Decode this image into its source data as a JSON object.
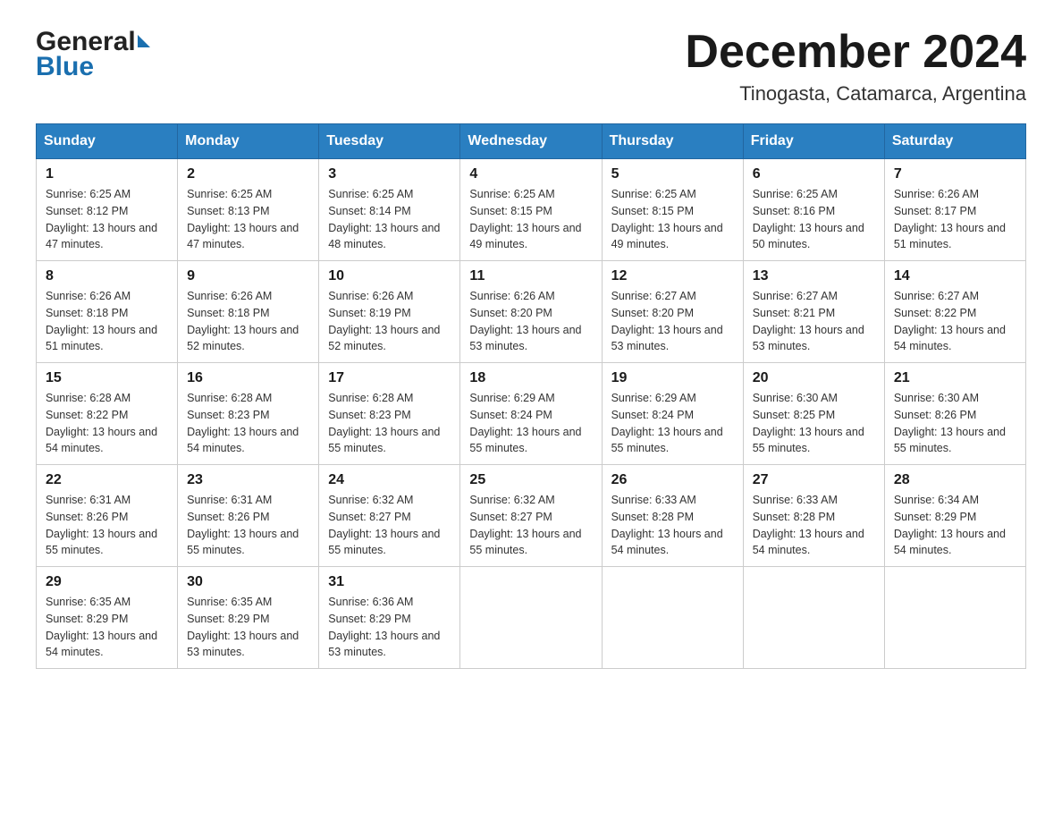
{
  "header": {
    "month_year": "December 2024",
    "location": "Tinogasta, Catamarca, Argentina",
    "logo_general": "General",
    "logo_blue": "Blue"
  },
  "days_of_week": [
    "Sunday",
    "Monday",
    "Tuesday",
    "Wednesday",
    "Thursday",
    "Friday",
    "Saturday"
  ],
  "weeks": [
    [
      {
        "day": "1",
        "sunrise": "6:25 AM",
        "sunset": "8:12 PM",
        "daylight": "13 hours and 47 minutes."
      },
      {
        "day": "2",
        "sunrise": "6:25 AM",
        "sunset": "8:13 PM",
        "daylight": "13 hours and 47 minutes."
      },
      {
        "day": "3",
        "sunrise": "6:25 AM",
        "sunset": "8:14 PM",
        "daylight": "13 hours and 48 minutes."
      },
      {
        "day": "4",
        "sunrise": "6:25 AM",
        "sunset": "8:15 PM",
        "daylight": "13 hours and 49 minutes."
      },
      {
        "day": "5",
        "sunrise": "6:25 AM",
        "sunset": "8:15 PM",
        "daylight": "13 hours and 49 minutes."
      },
      {
        "day": "6",
        "sunrise": "6:25 AM",
        "sunset": "8:16 PM",
        "daylight": "13 hours and 50 minutes."
      },
      {
        "day": "7",
        "sunrise": "6:26 AM",
        "sunset": "8:17 PM",
        "daylight": "13 hours and 51 minutes."
      }
    ],
    [
      {
        "day": "8",
        "sunrise": "6:26 AM",
        "sunset": "8:18 PM",
        "daylight": "13 hours and 51 minutes."
      },
      {
        "day": "9",
        "sunrise": "6:26 AM",
        "sunset": "8:18 PM",
        "daylight": "13 hours and 52 minutes."
      },
      {
        "day": "10",
        "sunrise": "6:26 AM",
        "sunset": "8:19 PM",
        "daylight": "13 hours and 52 minutes."
      },
      {
        "day": "11",
        "sunrise": "6:26 AM",
        "sunset": "8:20 PM",
        "daylight": "13 hours and 53 minutes."
      },
      {
        "day": "12",
        "sunrise": "6:27 AM",
        "sunset": "8:20 PM",
        "daylight": "13 hours and 53 minutes."
      },
      {
        "day": "13",
        "sunrise": "6:27 AM",
        "sunset": "8:21 PM",
        "daylight": "13 hours and 53 minutes."
      },
      {
        "day": "14",
        "sunrise": "6:27 AM",
        "sunset": "8:22 PM",
        "daylight": "13 hours and 54 minutes."
      }
    ],
    [
      {
        "day": "15",
        "sunrise": "6:28 AM",
        "sunset": "8:22 PM",
        "daylight": "13 hours and 54 minutes."
      },
      {
        "day": "16",
        "sunrise": "6:28 AM",
        "sunset": "8:23 PM",
        "daylight": "13 hours and 54 minutes."
      },
      {
        "day": "17",
        "sunrise": "6:28 AM",
        "sunset": "8:23 PM",
        "daylight": "13 hours and 55 minutes."
      },
      {
        "day": "18",
        "sunrise": "6:29 AM",
        "sunset": "8:24 PM",
        "daylight": "13 hours and 55 minutes."
      },
      {
        "day": "19",
        "sunrise": "6:29 AM",
        "sunset": "8:24 PM",
        "daylight": "13 hours and 55 minutes."
      },
      {
        "day": "20",
        "sunrise": "6:30 AM",
        "sunset": "8:25 PM",
        "daylight": "13 hours and 55 minutes."
      },
      {
        "day": "21",
        "sunrise": "6:30 AM",
        "sunset": "8:26 PM",
        "daylight": "13 hours and 55 minutes."
      }
    ],
    [
      {
        "day": "22",
        "sunrise": "6:31 AM",
        "sunset": "8:26 PM",
        "daylight": "13 hours and 55 minutes."
      },
      {
        "day": "23",
        "sunrise": "6:31 AM",
        "sunset": "8:26 PM",
        "daylight": "13 hours and 55 minutes."
      },
      {
        "day": "24",
        "sunrise": "6:32 AM",
        "sunset": "8:27 PM",
        "daylight": "13 hours and 55 minutes."
      },
      {
        "day": "25",
        "sunrise": "6:32 AM",
        "sunset": "8:27 PM",
        "daylight": "13 hours and 55 minutes."
      },
      {
        "day": "26",
        "sunrise": "6:33 AM",
        "sunset": "8:28 PM",
        "daylight": "13 hours and 54 minutes."
      },
      {
        "day": "27",
        "sunrise": "6:33 AM",
        "sunset": "8:28 PM",
        "daylight": "13 hours and 54 minutes."
      },
      {
        "day": "28",
        "sunrise": "6:34 AM",
        "sunset": "8:29 PM",
        "daylight": "13 hours and 54 minutes."
      }
    ],
    [
      {
        "day": "29",
        "sunrise": "6:35 AM",
        "sunset": "8:29 PM",
        "daylight": "13 hours and 54 minutes."
      },
      {
        "day": "30",
        "sunrise": "6:35 AM",
        "sunset": "8:29 PM",
        "daylight": "13 hours and 53 minutes."
      },
      {
        "day": "31",
        "sunrise": "6:36 AM",
        "sunset": "8:29 PM",
        "daylight": "13 hours and 53 minutes."
      },
      null,
      null,
      null,
      null
    ]
  ],
  "labels": {
    "sunrise": "Sunrise:",
    "sunset": "Sunset:",
    "daylight": "Daylight:"
  }
}
